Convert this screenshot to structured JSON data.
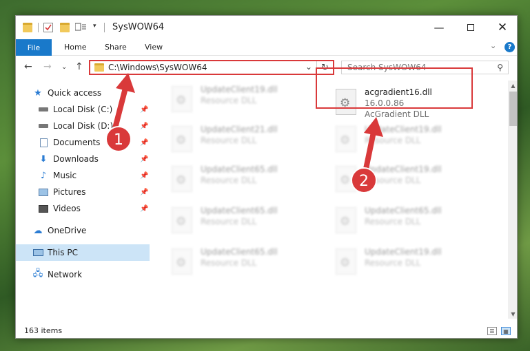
{
  "window": {
    "title": "SysWOW64"
  },
  "ribbon": {
    "tabs": [
      "File",
      "Home",
      "Share",
      "View"
    ],
    "help": "?"
  },
  "address": {
    "path": "C:\\Windows\\SysWOW64"
  },
  "search": {
    "placeholder": "Search SysWOW64"
  },
  "sidebar": {
    "items": [
      {
        "label": "Quick access",
        "icon": "star-icon"
      },
      {
        "label": "Local Disk (C:)",
        "icon": "drive-icon"
      },
      {
        "label": "Local Disk (D:)",
        "icon": "drive-icon"
      },
      {
        "label": "Documents",
        "icon": "documents-icon"
      },
      {
        "label": "Downloads",
        "icon": "download-icon"
      },
      {
        "label": "Music",
        "icon": "music-icon"
      },
      {
        "label": "Pictures",
        "icon": "pictures-icon"
      },
      {
        "label": "Videos",
        "icon": "videos-icon"
      },
      {
        "label": "OneDrive",
        "icon": "cloud-icon"
      },
      {
        "label": "This PC",
        "icon": "computer-icon"
      },
      {
        "label": "Network",
        "icon": "network-icon"
      }
    ]
  },
  "files": {
    "left": [
      {
        "name": "UpdateClient19.dll",
        "desc": "Resource DLL"
      },
      {
        "name": "UpdateClient21.dll",
        "desc": "Resource DLL"
      },
      {
        "name": "UpdateClient65.dll",
        "desc": "Resource DLL"
      },
      {
        "name": "UpdateClient65.dll",
        "desc": "Resource DLL"
      },
      {
        "name": "UpdateClient65.dll",
        "desc": "Resource DLL"
      }
    ],
    "right": [
      {
        "name": "acgradient16.dll",
        "desc": "16.0.0.86",
        "desc2": "AcGradient DLL"
      },
      {
        "name": "UpdateClient19.dll",
        "desc": "Resource DLL"
      },
      {
        "name": "UpdateClient19.dll",
        "desc": "Resource DLL"
      },
      {
        "name": "UpdateClient65.dll",
        "desc": "Resource DLL"
      },
      {
        "name": "UpdateClient19.dll",
        "desc": "Resource DLL"
      }
    ]
  },
  "status": {
    "count": "163 items"
  },
  "annotations": {
    "badge1": "1",
    "badge2": "2",
    "color": "#d9393a"
  }
}
